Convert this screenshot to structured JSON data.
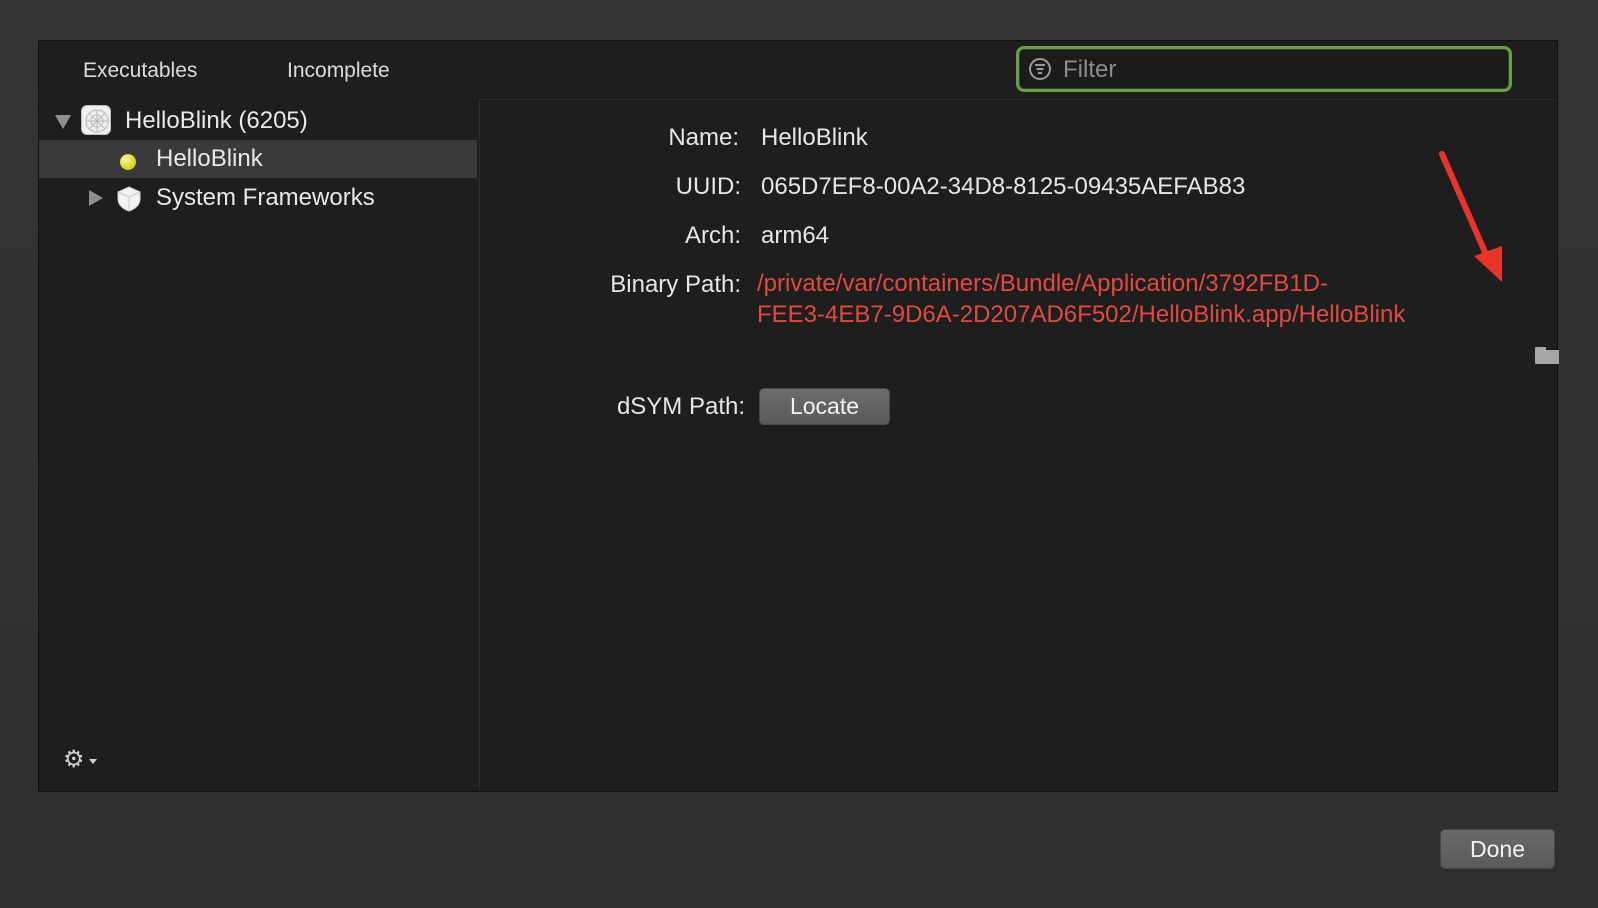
{
  "tabs": {
    "executables": "Executables",
    "incomplete": "Incomplete"
  },
  "filter": {
    "placeholder": "Filter",
    "value": ""
  },
  "tree": {
    "root": {
      "label": "HelloBlink (6205)",
      "expanded": true
    },
    "children": [
      {
        "label": "HelloBlink",
        "selected": true
      },
      {
        "label": "System Frameworks",
        "expanded": false
      }
    ]
  },
  "detail": {
    "name_label": "Name:",
    "name_value": "HelloBlink",
    "uuid_label": "UUID:",
    "uuid_value": "065D7EF8-00A2-34D8-8125-09435AEFAB83",
    "arch_label": "Arch:",
    "arch_value": "arm64",
    "binary_label": "Binary Path:",
    "binary_line1": "/private/var/containers/Bundle/Application/3792FB1D-",
    "binary_line2": "FEE3-4EB7-9D6A-2D207AD6F502/HelloBlink.app/HelloBlink",
    "dsym_label": "dSYM Path:",
    "locate_label": "Locate"
  },
  "footer": {
    "done_label": "Done"
  },
  "colors": {
    "accent_green": "#6c9e4a",
    "error_red": "#e24a3f",
    "annotation_red": "#e8342b"
  },
  "icons": [
    "filter-icon",
    "disclosure-triangle-icon",
    "app-icon",
    "yellow-dot-icon",
    "framework-shield-icon",
    "gear-icon",
    "folder-icon",
    "red-arrow-annotation"
  ]
}
